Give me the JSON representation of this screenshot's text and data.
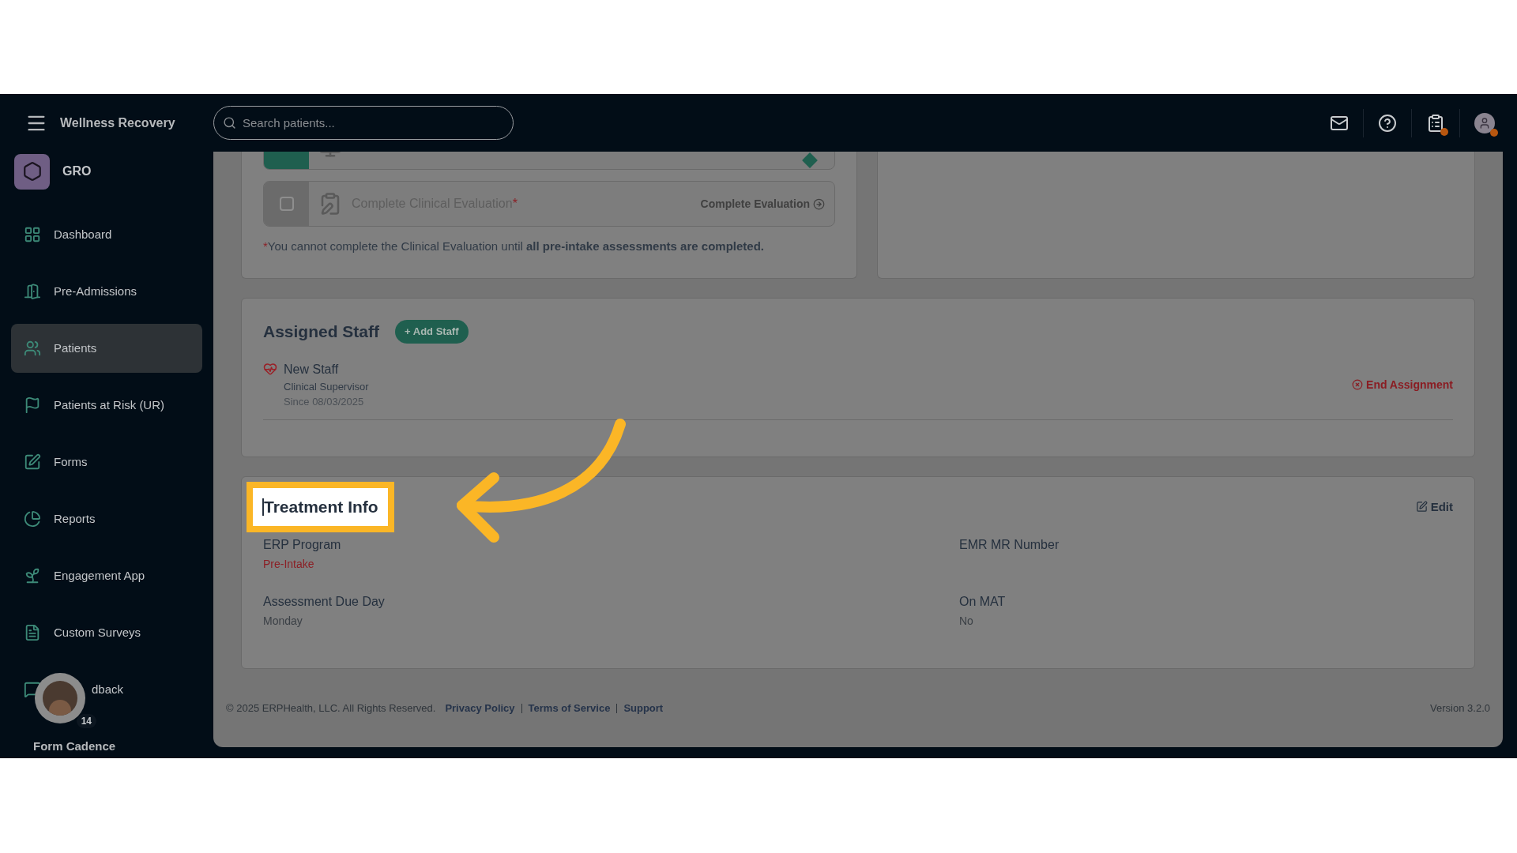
{
  "app": {
    "org_name": "Wellness Recovery"
  },
  "search": {
    "placeholder": "Search patients..."
  },
  "header_icons": [
    {
      "kind": "mail",
      "notification": false
    },
    {
      "kind": "help",
      "notification": false
    },
    {
      "kind": "clipboard",
      "notification": true
    },
    {
      "kind": "avatar",
      "notification": true
    }
  ],
  "workspace": {
    "name": "GRO"
  },
  "sidebar": {
    "items": [
      {
        "kind": "dashboard",
        "label": "Dashboard",
        "selected": false
      },
      {
        "kind": "door",
        "label": "Pre-Admissions",
        "selected": false
      },
      {
        "kind": "people",
        "label": "Patients",
        "selected": true
      },
      {
        "kind": "flag",
        "label": "Patients at Risk (UR)",
        "selected": false
      },
      {
        "kind": "edit",
        "label": "Forms",
        "selected": false
      },
      {
        "kind": "pie",
        "label": "Reports",
        "selected": false
      },
      {
        "kind": "sprout",
        "label": "Engagement App",
        "selected": false
      },
      {
        "kind": "survey",
        "label": "Custom Surveys",
        "selected": false
      },
      {
        "kind": "feedback",
        "label": "dback",
        "selected": false
      }
    ]
  },
  "floating_widget": {
    "count": "14",
    "label": "Form Cadence"
  },
  "tasks": [
    {
      "kind": "done",
      "checked": true
    },
    {
      "kind": "pending",
      "checked": false,
      "label": "Complete Clinical Evaluation",
      "required_mark": "*",
      "action": "Complete Evaluation"
    }
  ],
  "task_note": {
    "mark": "*",
    "text": "You cannot complete the Clinical Evaluation until **all pre-intake assessments are completed.**"
  },
  "assigned_staff": {
    "title": "Assigned Staff",
    "add_button": "+ Add Staff",
    "staff": [
      {
        "name": "New Staff",
        "role": "Clinical Supervisor",
        "since": "Since 08/03/2025",
        "action": "End Assignment"
      }
    ]
  },
  "treatment_info": {
    "title": "Treatment Info",
    "edit": "Edit",
    "fields": [
      {
        "label": "ERP Program",
        "value": "Pre-Intake",
        "kind": "status"
      },
      {
        "label": "EMR MR Number",
        "kind": "plain"
      },
      {
        "label": "Assessment Due Day",
        "value": "Monday",
        "kind": "plain"
      },
      {
        "label": "On MAT",
        "value": "No",
        "kind": "plain"
      }
    ]
  },
  "footer": {
    "copyright": "© 2025 ERPHealth, LLC. All Rights Reserved.",
    "links": [
      "Privacy Policy",
      "Terms of Service",
      "Support"
    ],
    "version": "Version 3.2.0"
  }
}
